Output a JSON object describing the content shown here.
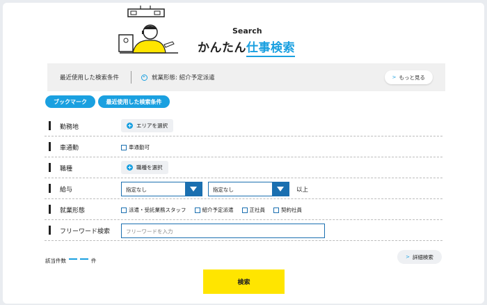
{
  "header": {
    "subtitle": "Search",
    "title_prefix": "かんたん",
    "title_accent": "仕事検索"
  },
  "recent": {
    "title": "最近使用した検索条件",
    "condition": "就業形態: 紹介予定派遣",
    "more_label": "もっと見る"
  },
  "tabs": {
    "bookmark": "ブックマーク",
    "recent": "最近使用した検索条件"
  },
  "form": {
    "location": {
      "label": "勤務地",
      "button": "エリアを選択"
    },
    "commute": {
      "label": "車通勤",
      "option": "車通勤可"
    },
    "job_type": {
      "label": "職種",
      "button": "職種を選択"
    },
    "salary": {
      "label": "給与",
      "min_value": "指定なし",
      "max_value": "指定なし",
      "suffix": "以上"
    },
    "employment": {
      "label": "就業形態",
      "options": [
        "派遣・受託業務スタッフ",
        "紹介予定派遣",
        "正社員",
        "契約社員"
      ]
    },
    "freeword": {
      "label": "フリーワード検索",
      "placeholder": "フリーワードを入力"
    }
  },
  "footer": {
    "count_label": "該当件数",
    "count_unit": "件",
    "detail_label": "詳細検索",
    "search_label": "検索"
  },
  "colors": {
    "accent": "#1aa0e0",
    "select": "#1a6fb0",
    "search_button": "#ffe500"
  }
}
